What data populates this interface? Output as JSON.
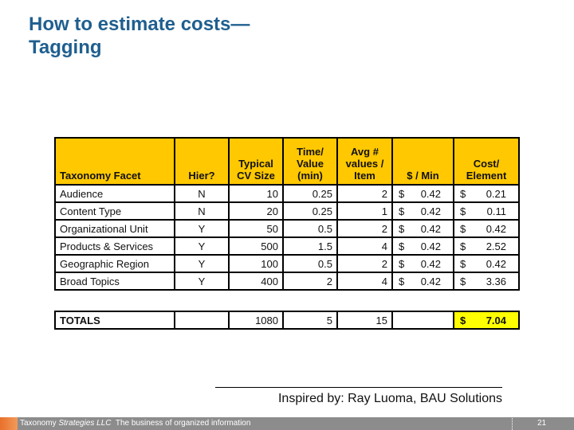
{
  "title": {
    "line1": "How to estimate costs—",
    "line2": "Tagging"
  },
  "table": {
    "headers": {
      "facet": "Taxonomy Facet",
      "hier": "Hier?",
      "cv_size": [
        "Typical",
        "CV Size"
      ],
      "time": [
        "Time/",
        "Value",
        "(min)"
      ],
      "avg": [
        "Avg #",
        "values /",
        "Item"
      ],
      "rate": "$ / Min",
      "cost": [
        "Cost/",
        "Element"
      ]
    },
    "rows": [
      {
        "facet": "Audience",
        "hier": "N",
        "cv_size": "10",
        "time": "0.25",
        "avg": "2",
        "rate_sym": "$",
        "rate": "0.42",
        "cost_sym": "$",
        "cost": "0.21"
      },
      {
        "facet": "Content Type",
        "hier": "N",
        "cv_size": "20",
        "time": "0.25",
        "avg": "1",
        "rate_sym": "$",
        "rate": "0.42",
        "cost_sym": "$",
        "cost": "0.11"
      },
      {
        "facet": "Organizational Unit",
        "hier": "Y",
        "cv_size": "50",
        "time": "0.5",
        "avg": "2",
        "rate_sym": "$",
        "rate": "0.42",
        "cost_sym": "$",
        "cost": "0.42"
      },
      {
        "facet": "Products & Services",
        "hier": "Y",
        "cv_size": "500",
        "time": "1.5",
        "avg": "4",
        "rate_sym": "$",
        "rate": "0.42",
        "cost_sym": "$",
        "cost": "2.52"
      },
      {
        "facet": "Geographic Region",
        "hier": "Y",
        "cv_size": "100",
        "time": "0.5",
        "avg": "2",
        "rate_sym": "$",
        "rate": "0.42",
        "cost_sym": "$",
        "cost": "0.42"
      },
      {
        "facet": "Broad Topics",
        "hier": "Y",
        "cv_size": "400",
        "time": "2",
        "avg": "4",
        "rate_sym": "$",
        "rate": "0.42",
        "cost_sym": "$",
        "cost": "3.36"
      }
    ],
    "totals": {
      "label": "TOTALS",
      "hier": "",
      "cv_size": "1080",
      "time": "5",
      "avg": "15",
      "rate": "",
      "cost_sym": "$",
      "cost": "7.04"
    }
  },
  "credit": "Inspired by: Ray Luoma, BAU Solutions",
  "footer": {
    "company_prefix": "Taxonomy ",
    "company_italic": "Strategies LLC",
    "tagline": "  The business of organized information",
    "page_number": "21"
  },
  "colors": {
    "title": "#1f5f8f",
    "header_fill": "#ffc800",
    "total_highlight": "#ffff00",
    "footer_bar": "#8c8c8c",
    "logo_accent": "#e8702a"
  }
}
